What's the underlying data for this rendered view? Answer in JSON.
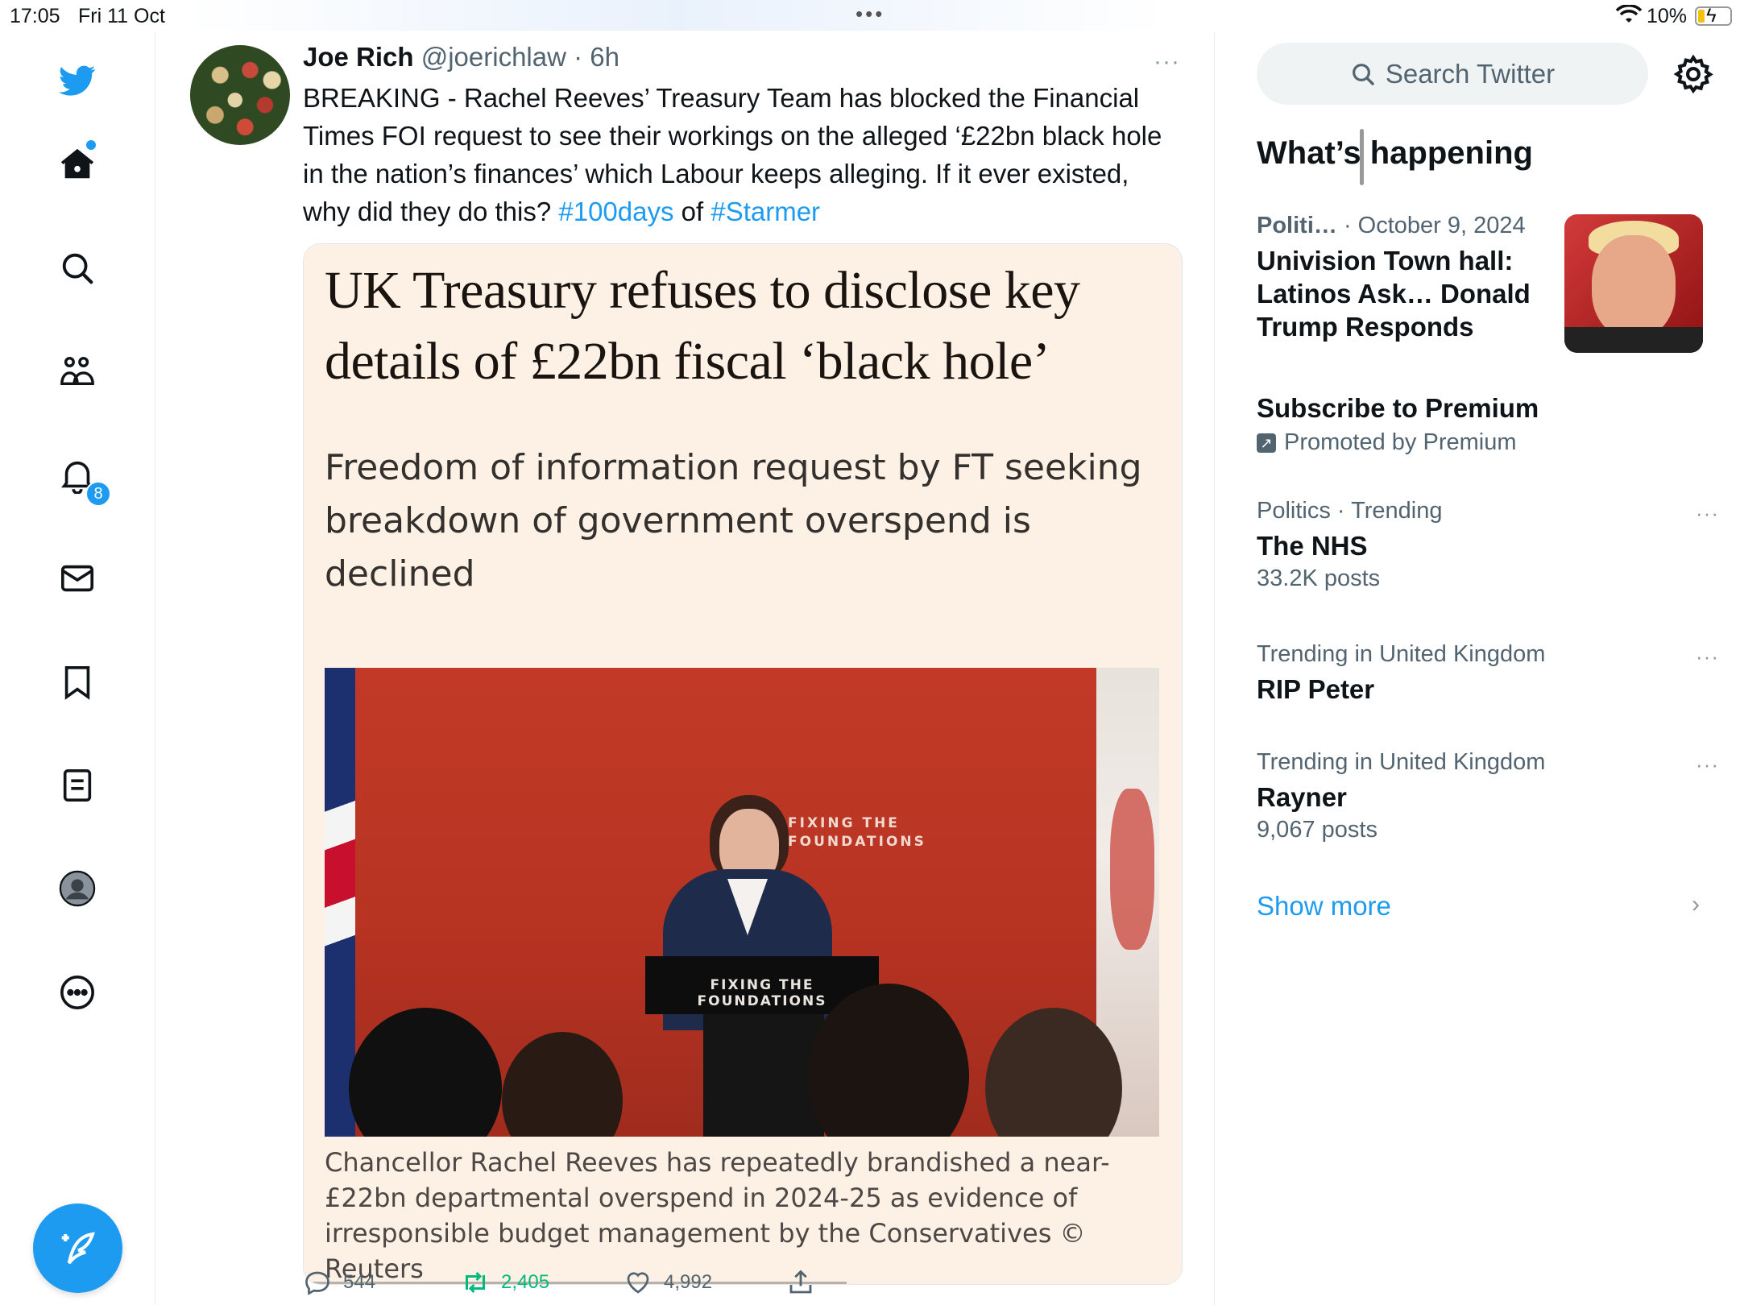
{
  "status_bar": {
    "time": "17:05",
    "date": "Fri 11 Oct",
    "battery": "10%",
    "multitask": "•••"
  },
  "nav": {
    "notifications_badge": "8",
    "items": [
      "home-icon",
      "search-icon",
      "communities-icon",
      "notifications-icon",
      "messages-icon",
      "bookmarks-icon",
      "lists-icon",
      "profile-icon",
      "more-icon"
    ]
  },
  "tweet": {
    "name": "Joe Rich",
    "handle": "@joerichlaw",
    "separator": " · ",
    "time": "6h",
    "more": "···",
    "text": "BREAKING - Rachel Reeves’ Treasury Team has blocked the Financial Times FOI request to see their workings on the alleged ‘£22bn black hole in the nation’s finances’ which Labour keeps alleging. If it ever existed, why did they do this? ",
    "hashtag1": "#100days",
    "conj": " of ",
    "hashtag2": "#Starmer",
    "card": {
      "headline": "UK Treasury refuses to disclose key details of £22bn fiscal ‘black hole’",
      "standfirst": "Freedom of information request by FT seeking breakdown of government overspend is declined",
      "backdrop_text_line1": "FIXING THE",
      "backdrop_text_line2": "FOUNDATIONS",
      "podium_text": "FIXING THE FOUNDATIONS",
      "caption": "Chancellor Rachel Reeves has repeatedly brandished a near-£22bn departmental overspend in 2024-25 as evidence of irresponsible budget management by the Conservatives © Reuters"
    },
    "actions": {
      "replies": "544",
      "retweets": "2,405",
      "likes": "4,992"
    }
  },
  "sidebar": {
    "search_placeholder": "Search Twitter",
    "section_title": "What’s happening",
    "news": {
      "category": "Politi…",
      "date": "· October 9, 2024",
      "title": "Univision Town hall: Latinos Ask… Donald Trump Responds"
    },
    "promo": {
      "title": "Subscribe to Premium",
      "promoted_by": "Promoted by Premium"
    },
    "trends": [
      {
        "meta": "Politics · Trending",
        "title": "The NHS",
        "count": "33.2K posts"
      },
      {
        "meta": "Trending in United Kingdom",
        "title": "RIP Peter",
        "count": ""
      },
      {
        "meta": "Trending in United Kingdom",
        "title": "Rayner",
        "count": "9,067 posts"
      }
    ],
    "trend_more": "···",
    "show_more": "Show more",
    "show_more_chevron": "›"
  },
  "colors": {
    "accent": "#1d9bf0",
    "retweet": "#00ba7c",
    "ft_pink": "#fdf1e5"
  }
}
